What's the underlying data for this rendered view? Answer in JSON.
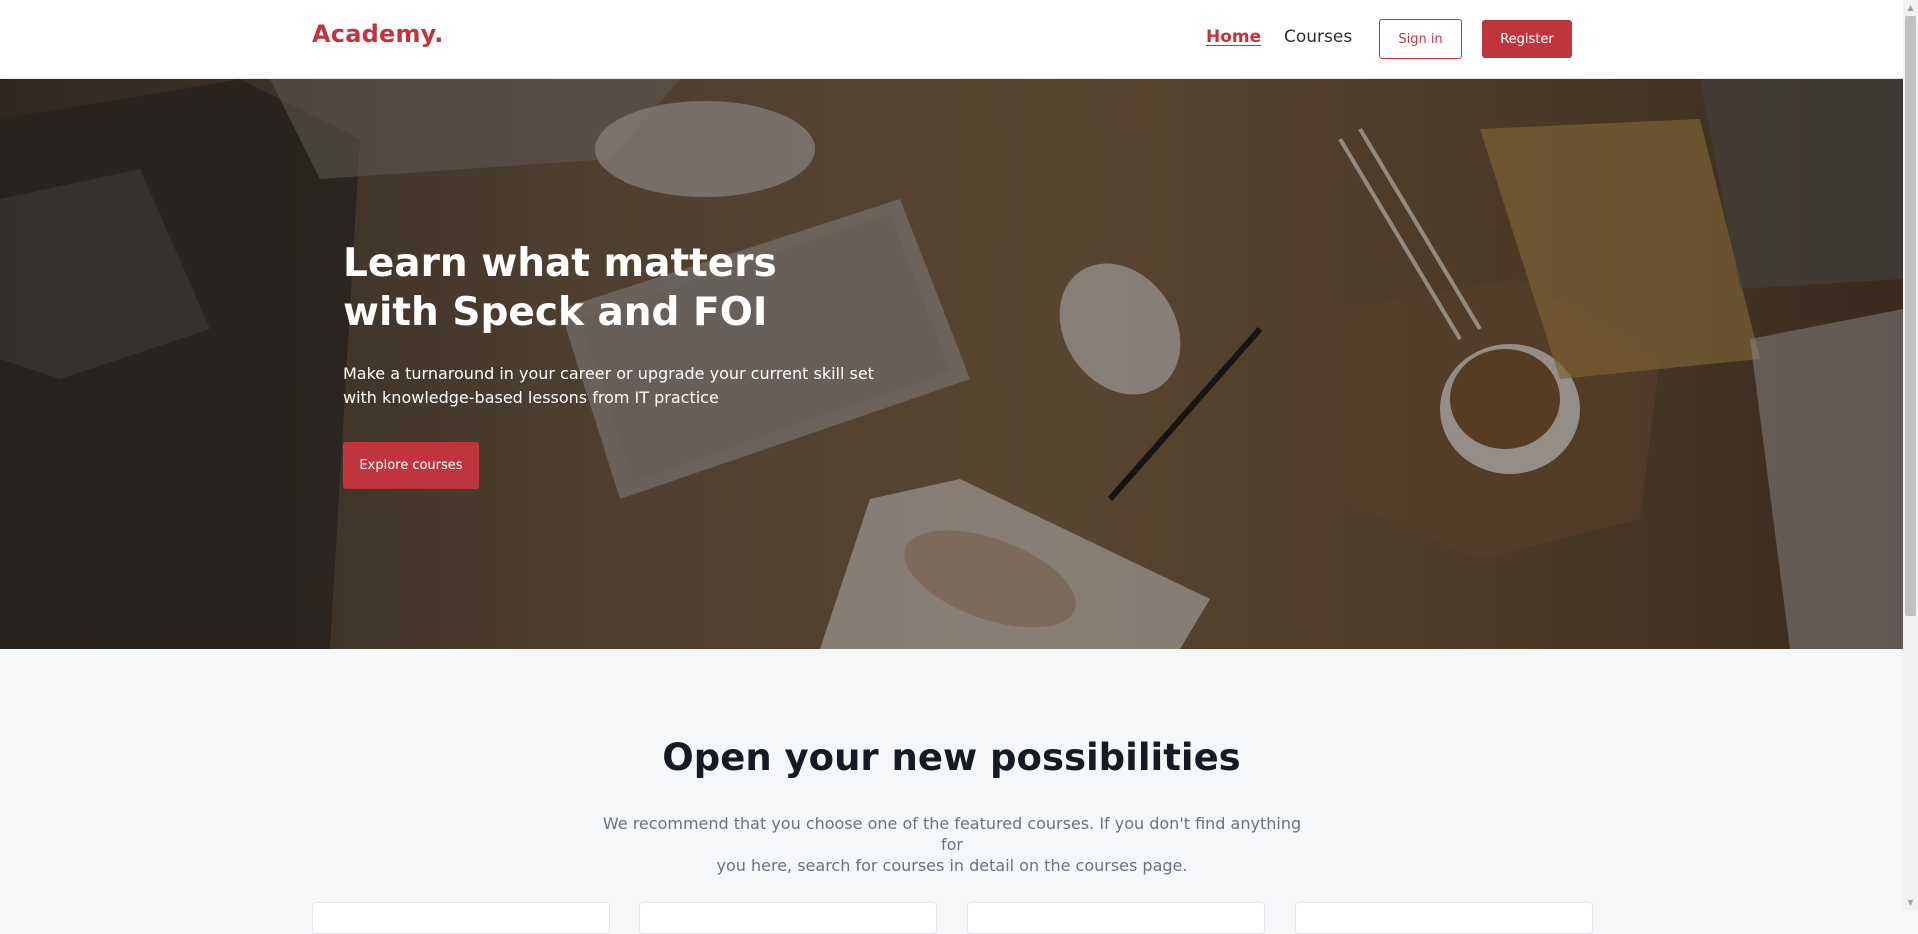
{
  "header": {
    "logo": "Academy.",
    "nav": {
      "home_label": "Home",
      "courses_label": "Courses"
    },
    "signin_label": "Sign in",
    "register_label": "Register",
    "accent_color": "#c0343d"
  },
  "hero": {
    "title_line1": "Learn what matters",
    "title_line2": "with Speck and FOI",
    "subtitle_line1": "Make a turnaround in your career or upgrade your current skill set",
    "subtitle_line2": "with knowledge-based lessons from IT practice",
    "cta_label": "Explore courses"
  },
  "section": {
    "title": "Open your new possibilities",
    "desc_line1": "We recommend that you choose one of the featured courses. If you don't find anything for",
    "desc_line2": "you here, search for courses in detail on the courses page."
  },
  "icons": {
    "scroll_up": "chevron-up-icon",
    "scroll_down": "chevron-down-icon"
  }
}
